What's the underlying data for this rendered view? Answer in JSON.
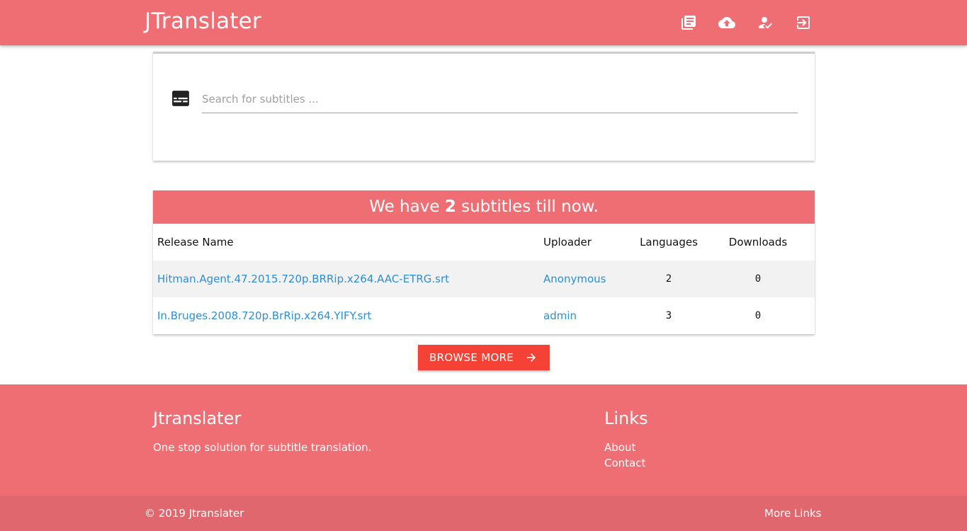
{
  "navbar": {
    "brand": "JTranslater",
    "icons": [
      "library-books-icon",
      "cloud-upload-icon",
      "how-to-reg-icon",
      "login-icon"
    ]
  },
  "search": {
    "icon": "subtitles-icon",
    "placeholder": "Search for subtitles ..."
  },
  "table": {
    "heading_prefix": "We have",
    "heading_count": "2",
    "heading_suffix": "subtitles till now.",
    "columns": [
      "Release Name",
      "Uploader",
      "Languages",
      "Downloads"
    ],
    "rows": [
      {
        "release": "Hitman.Agent.47.2015.720p.BRRip.x264.AAC-ETRG.srt",
        "uploader": "Anonymous",
        "languages": "2",
        "downloads": "0"
      },
      {
        "release": "In.Bruges.2008.720p.BrRip.x264.YIFY.srt",
        "uploader": "admin",
        "languages": "3",
        "downloads": "0"
      }
    ]
  },
  "browse": {
    "label": "Browse more",
    "icon": "arrow-forward-icon"
  },
  "footer": {
    "title": "Jtranslater",
    "description": "One stop solution for subtitle translation.",
    "links_title": "Links",
    "links": [
      "About",
      "Contact"
    ]
  },
  "copyright": {
    "text": "© 2019 Jtranslater",
    "more_links": "More Links"
  },
  "colors": {
    "primary": "#ef6e74",
    "accent": "#f44336",
    "link": "#2b8fd6",
    "copyright_bar": "#e0676d"
  }
}
